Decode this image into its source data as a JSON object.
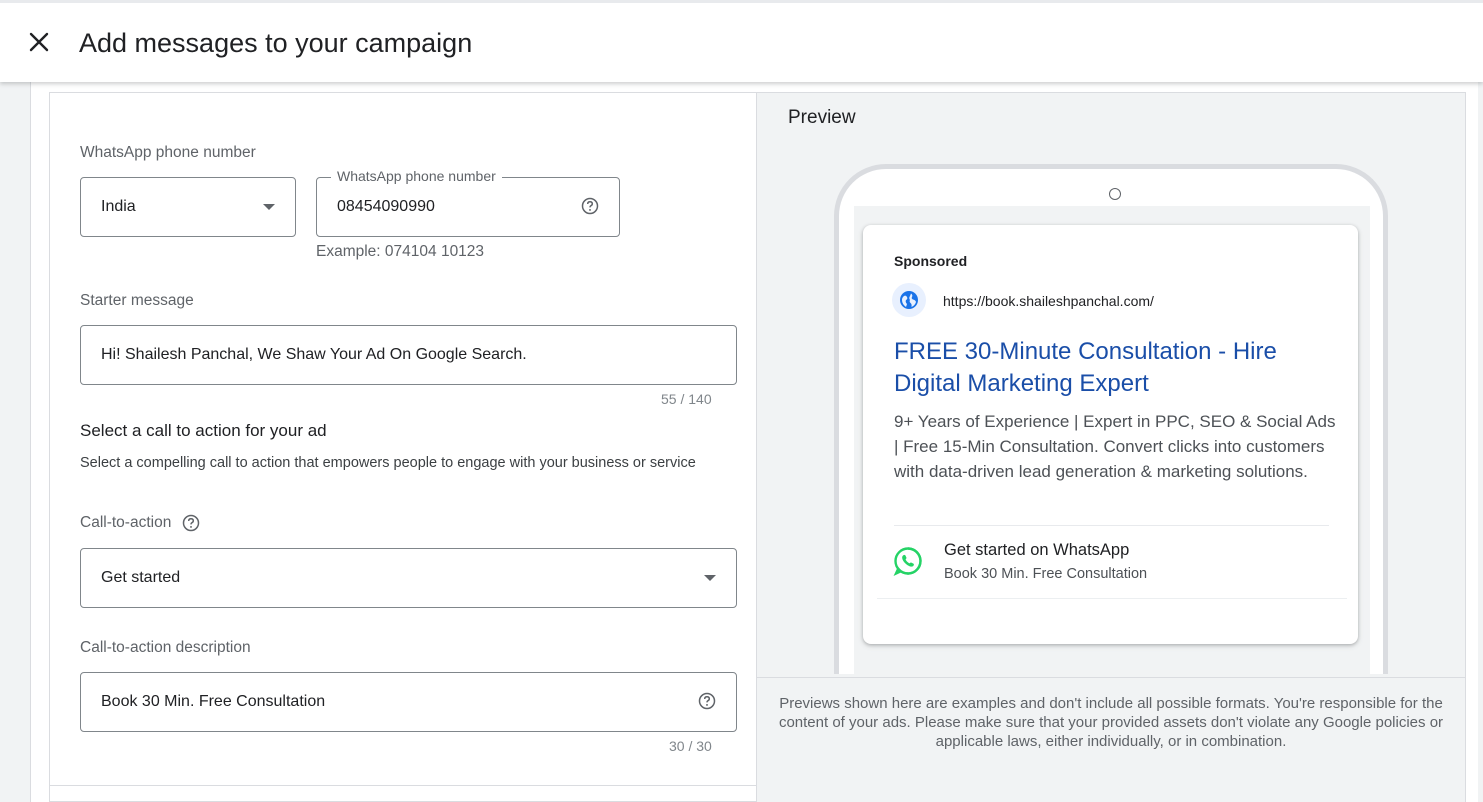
{
  "header": {
    "title": "Add messages to your campaign",
    "close_icon": "close-icon"
  },
  "form": {
    "whatsapp_section_label": "WhatsApp phone number",
    "country": {
      "value": "India"
    },
    "phone": {
      "floating_label": "WhatsApp phone number",
      "value": "08454090990",
      "hint": "Example: 074104 10123"
    },
    "starter": {
      "label": "Starter message",
      "value": "Hi! Shailesh Panchal, We Shaw Your Ad On Google Search.",
      "counter": "55 / 140"
    },
    "cta_section": {
      "heading": "Select a call to action for your ad",
      "description": "Select a compelling call to action that empowers people to engage with your business or service"
    },
    "cta": {
      "label": "Call-to-action",
      "value": "Get started"
    },
    "cta_description": {
      "label": "Call-to-action description",
      "value": "Book 30 Min. Free Consultation",
      "counter": "30 / 30"
    }
  },
  "preview": {
    "title": "Preview",
    "ad": {
      "sponsored": "Sponsored",
      "url": "https://book.shaileshpanchal.com/",
      "headline": "FREE 30-Minute Consultation - Hire Digital Marketing Expert",
      "description": "9+ Years of Experience | Expert in PPC, SEO & Social Ads | Free 15-Min Consultation. Convert clicks into customers with data-driven lead generation & marketing solutions.",
      "whatsapp_title": "Get started on WhatsApp",
      "whatsapp_subtitle": "Book 30 Min. Free Consultation"
    },
    "disclaimer": "Previews shown here are examples and don't include all possible formats. You're responsible for the content of your ads. Please make sure that your provided assets don't violate any Google policies or applicable laws, either individually, or in combination."
  },
  "colors": {
    "headline_blue": "#1a4ea8",
    "whatsapp_green": "#25d366",
    "globe_blue": "#1a73e8"
  }
}
